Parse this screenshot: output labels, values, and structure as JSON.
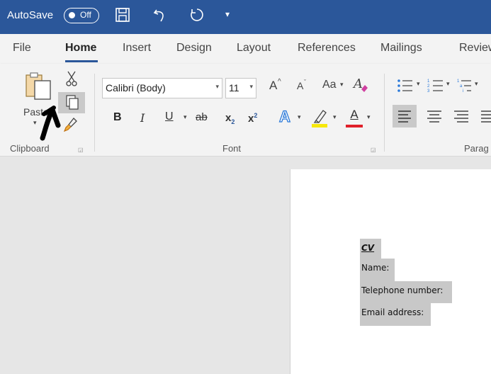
{
  "titlebar": {
    "autosave_label": "AutoSave",
    "toggle_state": "Off",
    "icons": [
      "save-icon",
      "undo-icon",
      "redo-icon",
      "customize-qat-icon"
    ]
  },
  "tabs": [
    "File",
    "Home",
    "Insert",
    "Design",
    "Layout",
    "References",
    "Mailings",
    "Review"
  ],
  "active_tab": "Home",
  "clipboard": {
    "paste_label": "Paste",
    "group_label": "Clipboard"
  },
  "font": {
    "font_name": "Calibri (Body)",
    "font_size": "11",
    "group_label": "Font",
    "bold": "B",
    "italic": "I",
    "underline": "U",
    "strikethrough": "ab",
    "subscript": "x",
    "superscript": "x",
    "text_effects": "A",
    "font_color": "A",
    "change_case": "Aa",
    "grow": "A",
    "shrink": "A"
  },
  "paragraph": {
    "group_label": "Parag"
  },
  "colors": {
    "accent": "#2b579a",
    "highlight": "#f7e80a",
    "font_color": "#e0202a",
    "selection": "#c8c8c8"
  },
  "document": {
    "heading": "CV",
    "lines": [
      "Name:",
      "Telephone number:",
      "Email address:"
    ]
  }
}
